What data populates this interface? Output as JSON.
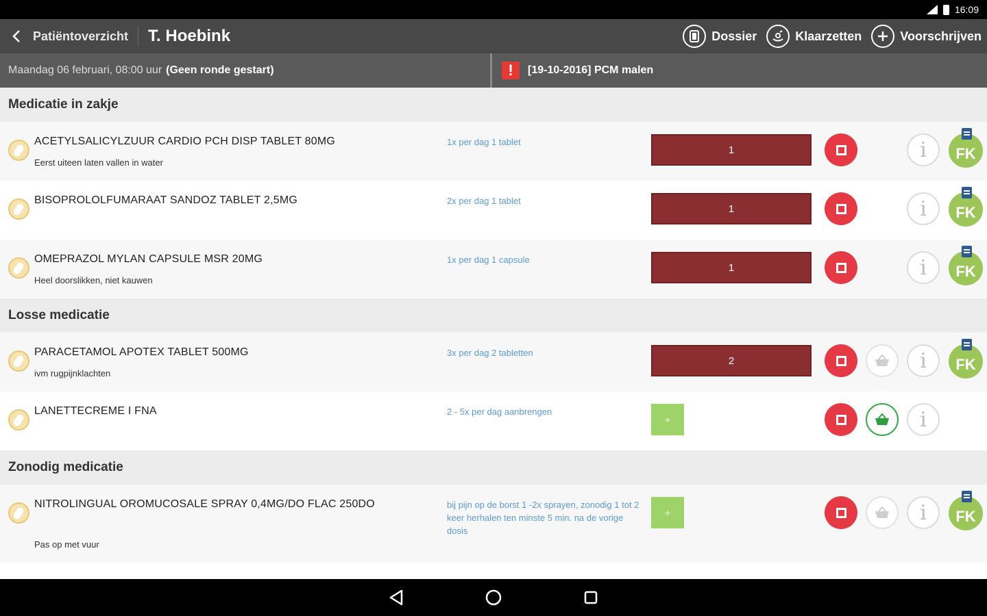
{
  "status": {
    "time": "16:09"
  },
  "header": {
    "back_label": "Patiëntoverzicht",
    "title": "T. Hoebink",
    "actions": {
      "dossier": "Dossier",
      "klaarzetten": "Klaarzetten",
      "voorschrijven": "Voorschrijven"
    }
  },
  "subbar": {
    "date": "Maandag 06 februari, 08:00 uur",
    "round_status": "(Geen ronde gestart)",
    "alert_text": "[19-10-2016] PCM malen"
  },
  "sections": [
    {
      "title": "Medicatie in zakje",
      "rows": [
        {
          "name": "ACETYLSALICYLZUUR CARDIO PCH DISP TABLET 80MG",
          "note": "Eerst uiteen laten vallen in water",
          "dosage": "1x per dag 1 tablet",
          "qty": "1"
        },
        {
          "name": "BISOPROLOLFUMARAAT SANDOZ TABLET  2,5MG",
          "note": "",
          "dosage": "2x per dag 1 tablet",
          "qty": "1"
        },
        {
          "name": "OMEPRAZOL MYLAN CAPSULE MSR 20MG",
          "note": "Heel doorslikken, niet kauwen",
          "dosage": "1x per dag 1 capsule",
          "qty": "1"
        }
      ]
    },
    {
      "title": "Losse medicatie",
      "rows": [
        {
          "name": "PARACETAMOL APOTEX TABLET 500MG",
          "note": "ivm rugpijnklachten",
          "dosage": "3x per dag 2 tabletten",
          "qty": "2"
        },
        {
          "name": "LANETTECREME I FNA",
          "note": "",
          "dosage": "2 - 5x per dag aanbrengen",
          "add": "+"
        }
      ]
    },
    {
      "title": "Zonodig medicatie",
      "rows": [
        {
          "name": "NITROLINGUAL OROMUCOSALE SPRAY 0,4MG/DO FLAC 250DO",
          "note": "Pas op met vuur",
          "dosage": "bij pijn op de borst 1 -2x sprayen, zonodig 1 tot 2 keer herhalen ten minste 5 min. na de vorige dosis",
          "add": "+"
        }
      ]
    }
  ],
  "fk_label": "FK",
  "info_label": "i",
  "colors": {
    "qty_bg": "#8b2e31",
    "stop": "#e53945",
    "fk": "#9cc65a",
    "add": "#9ed36a",
    "dosage": "#5b9bd5"
  }
}
